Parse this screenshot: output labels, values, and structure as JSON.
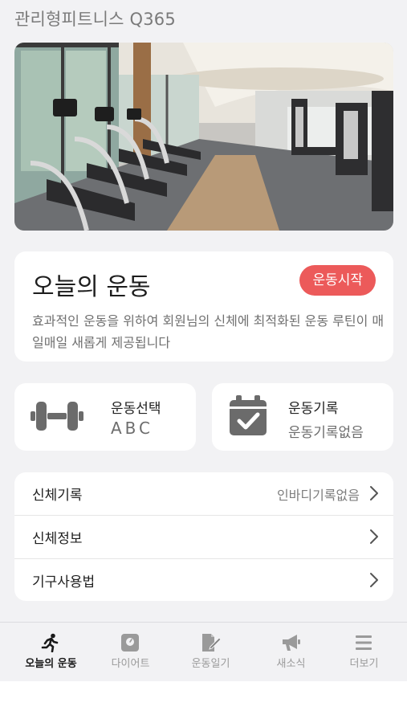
{
  "header": {
    "title": "관리형피트니스 Q365"
  },
  "today": {
    "title": "오늘의 운동",
    "start_label": "운동시작",
    "description": "효과적인 운동을 위하여 회원님의 신체에 최적화된 운동 루틴이 매일매일 새롭게 제공됩니다"
  },
  "cards": {
    "select": {
      "title": "운동선택",
      "value": "ABC",
      "icon": "dumbbell-icon"
    },
    "record": {
      "title": "운동기록",
      "value": "운동기록없음",
      "icon": "calendar-check-icon"
    }
  },
  "menu": [
    {
      "label": "신체기록",
      "value": "인바디기록없음"
    },
    {
      "label": "신체정보",
      "value": ""
    },
    {
      "label": "기구사용법",
      "value": ""
    }
  ],
  "tabs": [
    {
      "label": "오늘의 운동",
      "icon": "running-icon",
      "active": true
    },
    {
      "label": "다이어트",
      "icon": "scale-icon",
      "active": false
    },
    {
      "label": "운동일기",
      "icon": "note-edit-icon",
      "active": false
    },
    {
      "label": "새소식",
      "icon": "megaphone-icon",
      "active": false
    },
    {
      "label": "더보기",
      "icon": "menu-icon",
      "active": false
    }
  ],
  "colors": {
    "accent": "#ec5a5a",
    "icon_gray": "#6b6b6b",
    "background": "#f2f2f4"
  }
}
